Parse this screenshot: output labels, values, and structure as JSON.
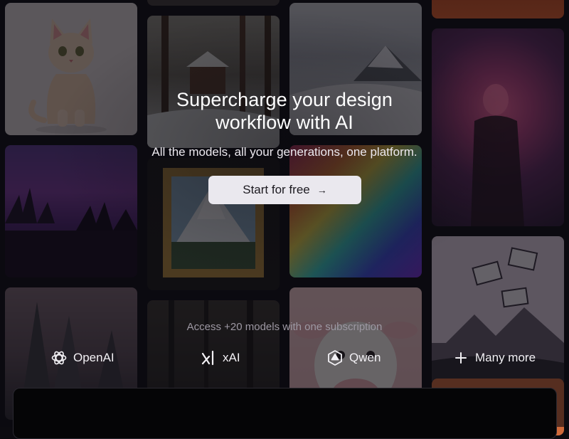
{
  "hero": {
    "headline_line1": "Supercharge your design",
    "headline_line2": "workflow with AI",
    "subline": "All the models, all your generations, one platform.",
    "cta_label": "Start for free",
    "cta_icon": "arrow-right-icon"
  },
  "models": {
    "caption": "Access +20 models with one subscription",
    "items": [
      {
        "label": "OpenAI",
        "icon": "openai-logo-icon"
      },
      {
        "label": "xAI",
        "icon": "xai-logo-icon"
      },
      {
        "label": "Qwen",
        "icon": "qwen-logo-icon"
      },
      {
        "label": "Many more",
        "icon": "plus-icon"
      }
    ]
  },
  "colors": {
    "background": "#0c0b10",
    "cta_background": "#eae8ee",
    "text_primary": "#ffffff",
    "text_muted": "#9d98a3"
  }
}
